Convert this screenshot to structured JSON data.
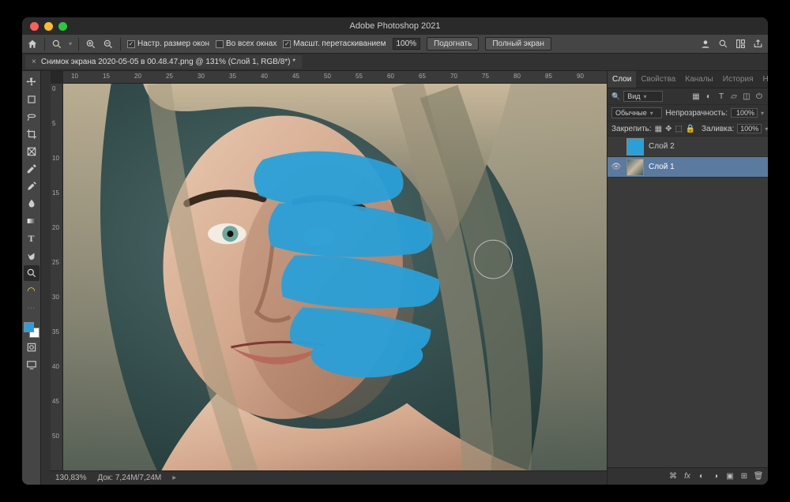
{
  "app_title": "Adobe Photoshop 2021",
  "document_tab": "Снимок экрана 2020-05-05 в 00.48.47.png @ 131% (Слой 1, RGB/8*) *",
  "optionsbar": {
    "resize_windows": "Настр. размер окон",
    "all_windows": "Во всех окнах",
    "scrubby_zoom": "Масшт. перетаскиванием",
    "zoom_pct": "100%",
    "fit": "Подогнать",
    "fullscreen": "Полный экран"
  },
  "ruler_h": [
    "10",
    "15",
    "20",
    "25",
    "30",
    "35",
    "40",
    "45",
    "50",
    "55",
    "60",
    "65",
    "70",
    "75",
    "80",
    "85",
    "90"
  ],
  "ruler_v": [
    "0",
    "5",
    "10",
    "15",
    "20",
    "25",
    "30",
    "35",
    "40",
    "45",
    "50"
  ],
  "status": {
    "zoom": "130,83%",
    "doc": "Док: 7,24M/7,24M"
  },
  "panel": {
    "tabs": [
      "Слои",
      "Свойства",
      "Каналы",
      "История",
      "Навигатор"
    ],
    "active_tab": 0,
    "filter_label": "Вид",
    "blend_mode": "Обычные",
    "opacity_label": "Непрозрачность:",
    "opacity_val": "100%",
    "lock_label": "Закрепить:",
    "fill_label": "Заливка:",
    "fill_val": "100%",
    "layers": [
      {
        "name": "Слой 2",
        "visible": false,
        "selected": false,
        "kind": "paint"
      },
      {
        "name": "Слой 1",
        "visible": true,
        "selected": true,
        "kind": "image"
      }
    ]
  },
  "footer_icons": [
    "link",
    "fx",
    "mask",
    "adjust",
    "group",
    "new",
    "trash"
  ],
  "colors": {
    "paint": "#2aa0d8"
  }
}
